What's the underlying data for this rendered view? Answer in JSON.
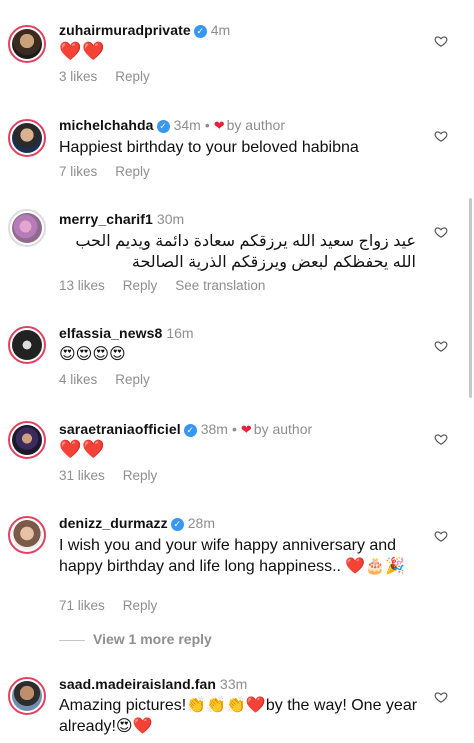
{
  "comments": [
    {
      "username": "zuhairmuradprivate",
      "verified": true,
      "time": "4m",
      "by_author": "",
      "text": "❤️❤️",
      "likes": "3 likes",
      "reply": "Reply",
      "see_translation": ""
    },
    {
      "username": "michelchahda",
      "verified": true,
      "time": "34m",
      "by_author": "by author",
      "text": "Happiest birthday to your beloved habibna",
      "likes": "7 likes",
      "reply": "Reply",
      "see_translation": ""
    },
    {
      "username": "merry_charif1",
      "verified": false,
      "time": "30m",
      "by_author": "",
      "text": "عيد زواج سعيد الله يرزقكم سعادة دائمة ويديم الحب الله يحفظكم لبعض ويرزقكم الذرية الصالحة",
      "likes": "13 likes",
      "reply": "Reply",
      "see_translation": "See translation"
    },
    {
      "username": "elfassia_news8",
      "verified": false,
      "time": "16m",
      "by_author": "",
      "text": "😍😍😍😍",
      "likes": "4 likes",
      "reply": "Reply",
      "see_translation": ""
    },
    {
      "username": "saraetraniaofficiel",
      "verified": true,
      "time": "38m",
      "by_author": "by author",
      "text": "❤️❤️",
      "likes": "31 likes",
      "reply": "Reply",
      "see_translation": ""
    },
    {
      "username": "denizz_durmazz",
      "verified": true,
      "time": "28m",
      "by_author": "",
      "text": "I wish you and your wife happy anniversary and happy birthday and life long happiness.. ❤️🎂🎉",
      "likes": "71 likes",
      "reply": "Reply",
      "see_translation": ""
    },
    {
      "username": "saad.madeiraisland.fan",
      "verified": false,
      "time": "33m",
      "by_author": "",
      "text": "Amazing pictures!👏👏👏❤️by the way! One year already!😍❤️",
      "likes": "",
      "reply": "",
      "see_translation": ""
    }
  ],
  "view_replies": "View 1 more reply",
  "icons": {
    "verified": "verified-badge-icon",
    "like": "heart-outline-icon",
    "author_heart": "heart-filled-icon"
  },
  "colors": {
    "verified_blue": "#3897f0",
    "heart_red": "#ed1f3a",
    "meta_gray": "#8e8e8e",
    "avatar_ring": "#e4405f"
  }
}
